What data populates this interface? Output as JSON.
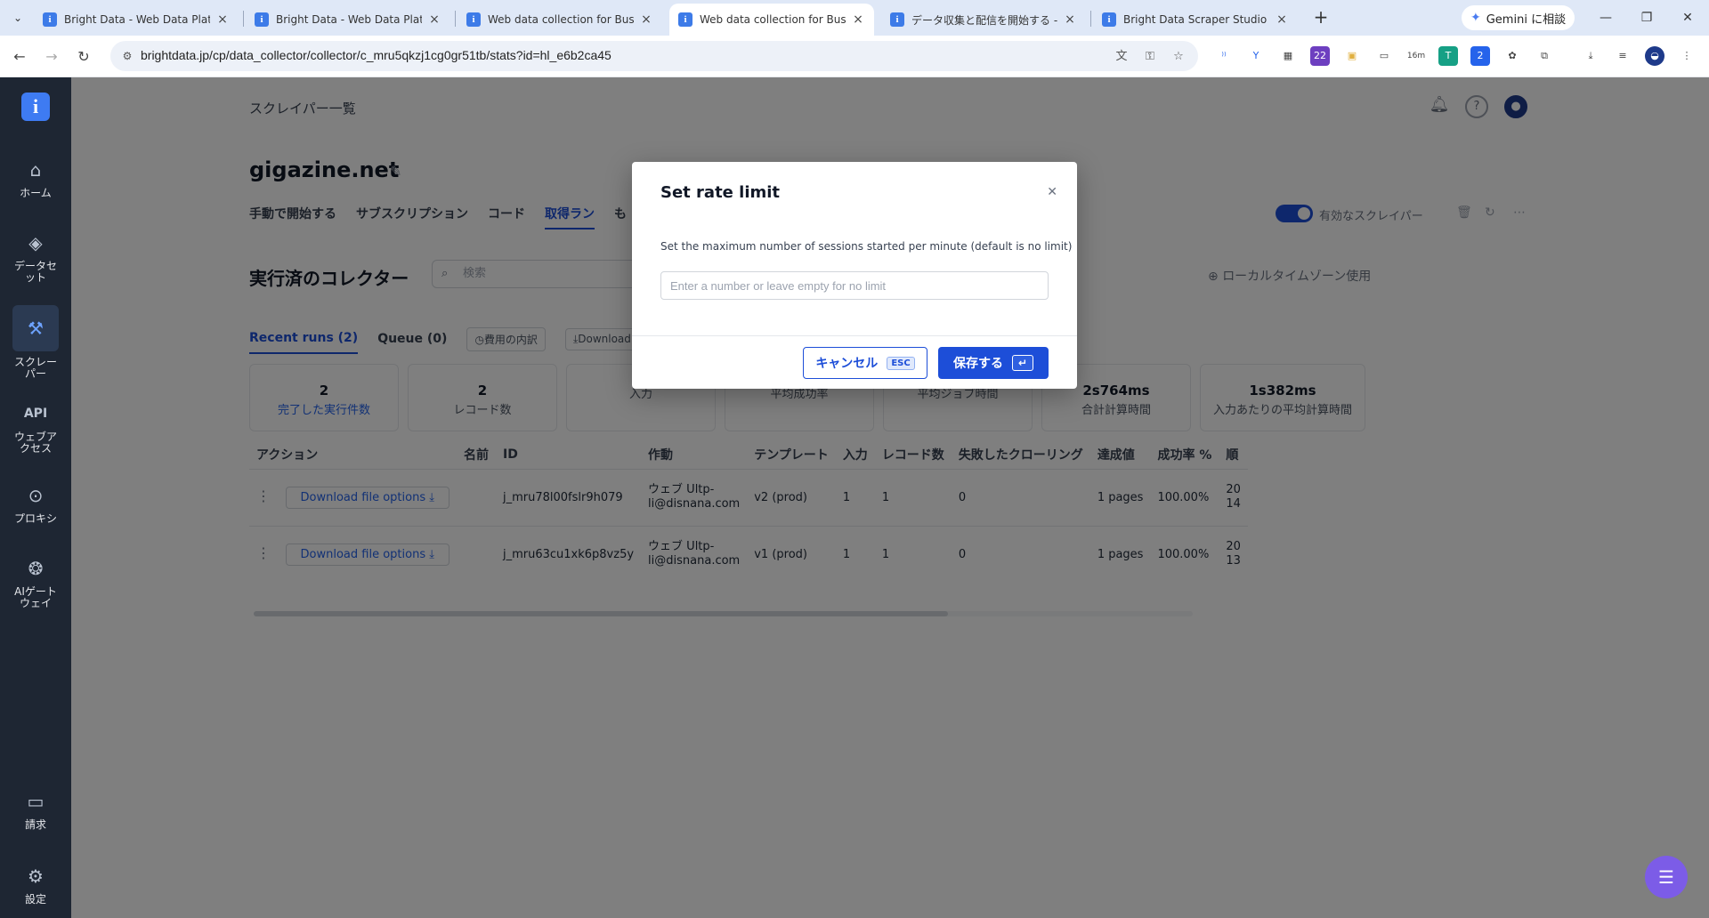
{
  "browser": {
    "tabs": [
      {
        "label": "Bright Data - Web Data Platform",
        "active": false
      },
      {
        "label": "Bright Data - Web Data Platform",
        "active": false
      },
      {
        "label": "Web data collection for Business",
        "active": false
      },
      {
        "label": "Web data collection for Business",
        "active": true
      },
      {
        "label": "データ収集と配信を開始する - Bright",
        "active": false
      },
      {
        "label": "Bright Data Scraper Studio API",
        "active": false
      }
    ],
    "gemini_label": "Gemini に相談",
    "url": "brightdata.jp/cp/data_collector/collector/c_mru5qkzj1cg0gr51tb/stats?id=hl_e6b2ca45",
    "ext_badges": {
      "badge1": "22",
      "badge2": "16m",
      "badge3": "2"
    }
  },
  "sidebar": {
    "items": [
      {
        "label": "ホーム",
        "icon": "home-icon"
      },
      {
        "label": "データセット",
        "icon": "layers-icon"
      },
      {
        "label": "スクレーパー",
        "icon": "scraper-icon",
        "active": true
      },
      {
        "label": "ウェブアクセス",
        "icon": "api-icon",
        "icon_text": "API"
      },
      {
        "label": "プロキシ",
        "icon": "location-pin-icon"
      },
      {
        "label": "AIゲートウェイ",
        "icon": "brain-icon"
      },
      {
        "label": "請求",
        "icon": "card-icon"
      },
      {
        "label": "設定",
        "icon": "gear-icon"
      }
    ]
  },
  "page": {
    "breadcrumb": "スクレイパー一覧",
    "title": "gigazine.net",
    "subtabs": [
      "手動で開始する",
      "サブスクリプション",
      "コード",
      "取得ラン",
      "も"
    ],
    "active_subtab": "取得ラン",
    "toggle_label": "有効なスクレイパー",
    "section_title": "実行済のコレクター",
    "search_placeholder": "検索",
    "timezone_label": "ローカルタイムゾーン使用",
    "run_tabs": {
      "recent": "Recent runs (2)",
      "queue": "Queue (0)",
      "cost": "費用の内訳",
      "download": "Download re"
    }
  },
  "stats": [
    {
      "value": "2",
      "label": "完了した実行件数"
    },
    {
      "value": "2",
      "label": "レコード数"
    },
    {
      "value": "",
      "label": "入力"
    },
    {
      "value": "",
      "label": "平均成功率"
    },
    {
      "value": "",
      "label": "平均ジョブ時間"
    },
    {
      "value": "2s764ms",
      "label": "合計計算時間"
    },
    {
      "value": "1s382ms",
      "label": "入力あたりの平均計算時間"
    }
  ],
  "table": {
    "headers": [
      "アクション",
      "名前",
      "ID",
      "作動",
      "テンプレート",
      "入力",
      "レコード数",
      "失敗したクローリング",
      "達成値",
      "成功率 %",
      "順"
    ],
    "rows": [
      {
        "action": "Download file options",
        "name": "",
        "id": "j_mru78l00fslr9h079",
        "operator_1": "ウェブ Ultp-",
        "operator_2": "li@disnana.com",
        "template": "v2 (prod)",
        "input": "1",
        "records": "1",
        "failed": "0",
        "achieved": "1 pages",
        "success": "100.00%",
        "date_1": "20",
        "date_2": "14"
      },
      {
        "action": "Download file options",
        "name": "",
        "id": "j_mru63cu1xk6p8vz5y",
        "operator_1": "ウェブ Ultp-",
        "operator_2": "li@disnana.com",
        "template": "v1 (prod)",
        "input": "1",
        "records": "1",
        "failed": "0",
        "achieved": "1 pages",
        "success": "100.00%",
        "date_1": "20",
        "date_2": "13"
      }
    ]
  },
  "modal": {
    "title": "Set rate limit",
    "description": "Set the maximum number of sessions started per minute (default is no limit)",
    "input_value": "",
    "input_placeholder": "Enter a number or leave empty for no limit",
    "cancel_label": "キャンセル",
    "cancel_key": "ESC",
    "save_label": "保存する",
    "save_key": "↵"
  },
  "colors": {
    "accent": "#1d4ed8",
    "sidebar_bg": "#1e2633",
    "chat": "#7c5ce7"
  }
}
